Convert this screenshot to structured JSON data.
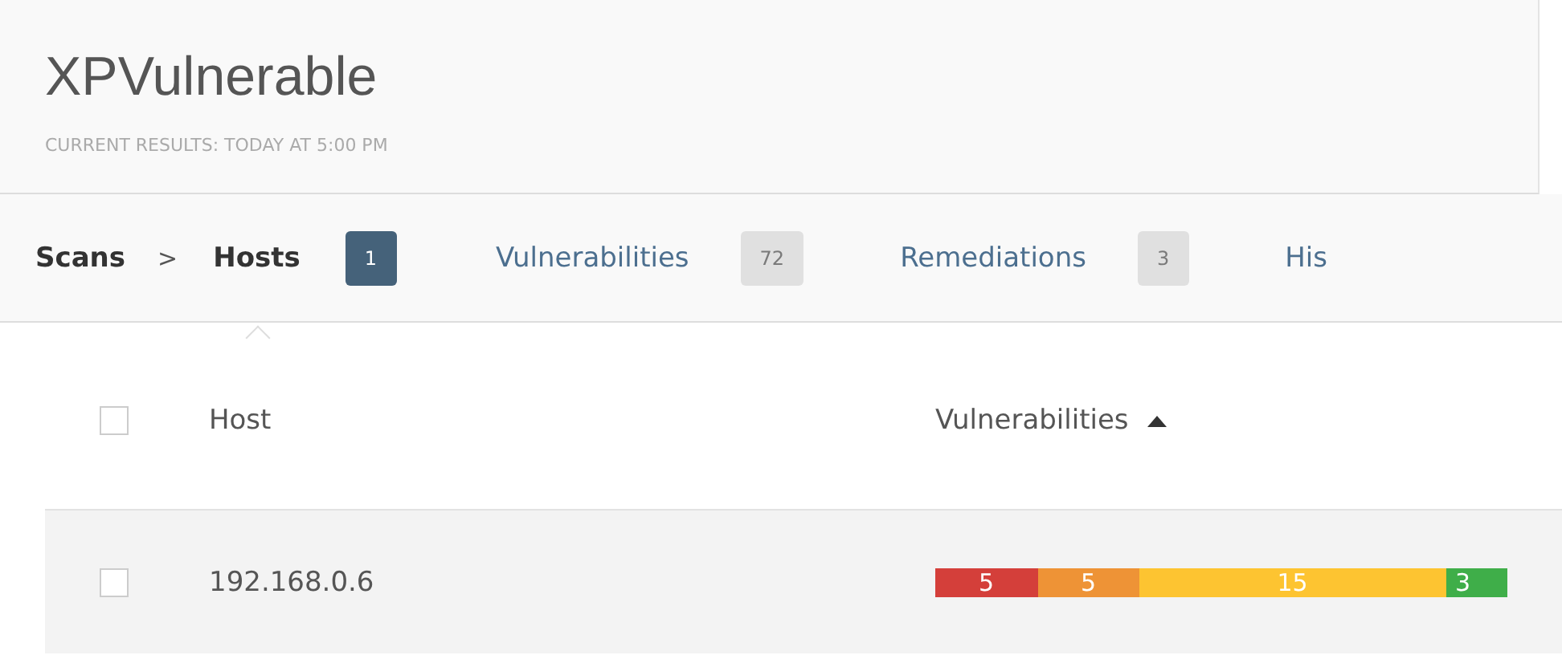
{
  "header": {
    "title": "XPVulnerable",
    "subtitle": "CURRENT RESULTS: TODAY AT 5:00 PM"
  },
  "breadcrumb": {
    "label": "Scans",
    "separator": ">"
  },
  "tabs": [
    {
      "label": "Hosts",
      "count": "1",
      "selected": true
    },
    {
      "label": "Vulnerabilities",
      "count": "72",
      "selected": false
    },
    {
      "label": "Remediations",
      "count": "3",
      "selected": false
    },
    {
      "label": "His",
      "selected": false
    }
  ],
  "table": {
    "select_all_checked": false,
    "columns": [
      {
        "label": "Host"
      },
      {
        "label": "Vulnerabilities",
        "sort_ascending": true
      }
    ],
    "rows": [
      {
        "checked": false,
        "host": "192.168.0.6",
        "vulnerabilities": [
          {
            "count": "5",
            "color": "#d43f3a"
          },
          {
            "count": "5",
            "color": "#ee9336"
          },
          {
            "count": "15",
            "color": "#fdc431"
          },
          {
            "count": "3",
            "color": "#3fae49"
          }
        ]
      }
    ]
  }
}
